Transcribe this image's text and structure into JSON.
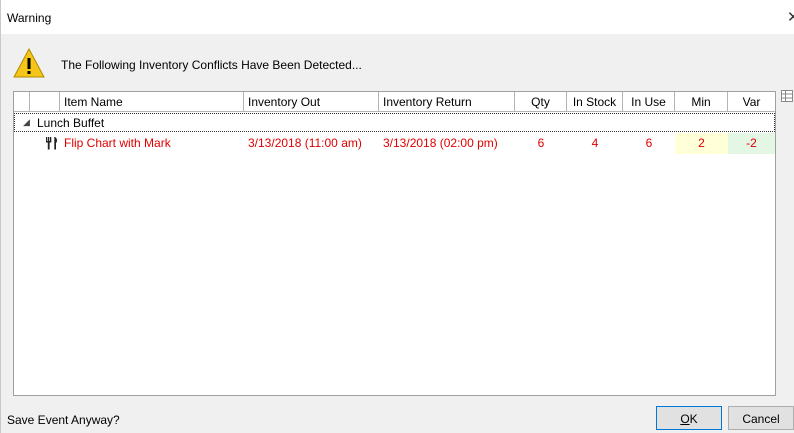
{
  "window": {
    "title": "Warning"
  },
  "header": {
    "message": "The Following Inventory Conflicts Have Been Detected..."
  },
  "grid": {
    "columns": [
      "Item Name",
      "Inventory Out",
      "Inventory Return",
      "Qty",
      "In Stock",
      "In Use",
      "Min",
      "Var"
    ],
    "group": {
      "label": "Lunch Buffet"
    },
    "rows": [
      {
        "item_name": "Flip Chart with Mark",
        "inventory_out": "3/13/2018 (11:00 am)",
        "inventory_return": "3/13/2018 (02:00 pm)",
        "qty": "6",
        "in_stock": "4",
        "in_use": "6",
        "min": "2",
        "var": "-2",
        "icon": "utensils-icon"
      }
    ]
  },
  "footer": {
    "prompt": "Save Event Anyway?",
    "ok_label": "K",
    "ok_mnemonic": "O",
    "cancel_label": "Cancel"
  },
  "colors": {
    "conflict_text": "#e00000",
    "min_highlight": "#ffffd8",
    "var_highlight": "#e4f7e4",
    "warning_yellow": "#f5c518"
  }
}
